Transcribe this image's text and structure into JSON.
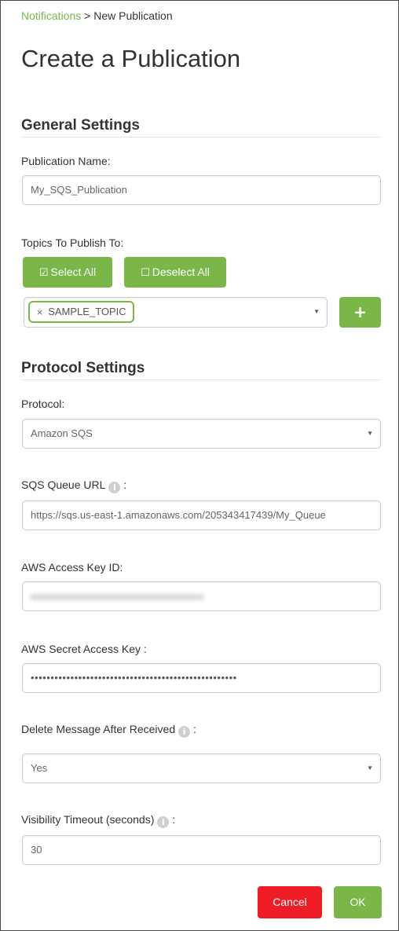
{
  "breadcrumb": {
    "parent": "Notifications",
    "separator": ">",
    "current": "New Publication"
  },
  "page_title": "Create a Publication",
  "general_settings": {
    "title": "General Settings",
    "publication_name": {
      "label": "Publication Name:",
      "value": "My_SQS_Publication"
    },
    "topics": {
      "label": "Topics To Publish To:",
      "select_all_label": "Select All",
      "deselect_all_label": "Deselect All",
      "selected_tags": [
        "SAMPLE_TOPIC"
      ],
      "add_button_glyph": "+"
    }
  },
  "protocol_settings": {
    "title": "Protocol Settings",
    "protocol": {
      "label": "Protocol:",
      "value": "Amazon SQS"
    },
    "sqs_queue_url": {
      "label": "SQS Queue URL",
      "suffix": ":",
      "value": "https://sqs.us-east-1.amazonaws.com/205343417439/My_Queue"
    },
    "aws_access_key_id": {
      "label": "AWS Access Key ID:",
      "value_redacted": true
    },
    "aws_secret_access_key": {
      "label": "AWS Secret Access Key :",
      "masked_value": "••••••••••••••••••••••••••••••••••••••••••••••••••••"
    },
    "delete_after_received": {
      "label": "Delete Message After Received",
      "suffix": ":",
      "value": "Yes"
    },
    "visibility_timeout": {
      "label": "Visibility Timeout (seconds)",
      "suffix": ":",
      "value": "30"
    }
  },
  "actions": {
    "cancel_label": "Cancel",
    "ok_label": "OK"
  },
  "icons": {
    "info": "i",
    "caret_down": "▼",
    "tag_remove": "×",
    "check_square": "☑",
    "empty_square": "☐"
  },
  "colors": {
    "accent_green": "#7ab648",
    "danger_red": "#ee1c25",
    "text": "#333333"
  }
}
